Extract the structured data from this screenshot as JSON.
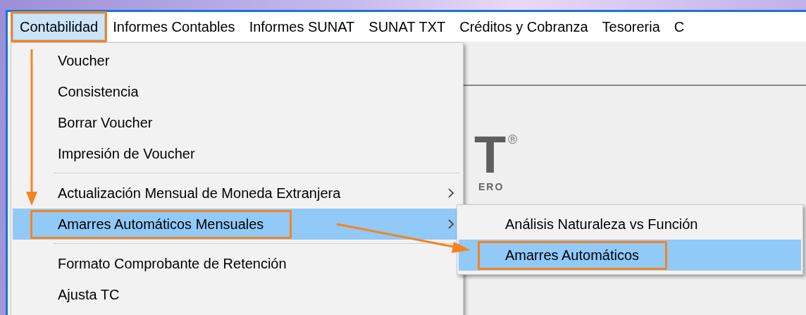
{
  "menu_bar": [
    {
      "label": "Contabilidad",
      "selected": true,
      "annotated": true
    },
    {
      "label": "Informes Contables",
      "selected": false,
      "annotated": false
    },
    {
      "label": "Informes SUNAT",
      "selected": false,
      "annotated": false
    },
    {
      "label": "SUNAT TXT",
      "selected": false,
      "annotated": false
    },
    {
      "label": "Créditos y Cobranza",
      "selected": false,
      "annotated": false
    },
    {
      "label": "Tesoreria",
      "selected": false,
      "annotated": false
    },
    {
      "label": "C",
      "selected": false,
      "annotated": false
    }
  ],
  "menu": {
    "items": [
      {
        "kind": "item",
        "label": "Voucher",
        "selected": false,
        "annotated": false,
        "has_submenu": false
      },
      {
        "kind": "item",
        "label": "Consistencia",
        "selected": false,
        "annotated": false,
        "has_submenu": false
      },
      {
        "kind": "item",
        "label": "Borrar Voucher",
        "selected": false,
        "annotated": false,
        "has_submenu": false
      },
      {
        "kind": "item",
        "label": "Impresión de Voucher",
        "selected": false,
        "annotated": false,
        "has_submenu": false
      },
      {
        "kind": "separator"
      },
      {
        "kind": "item",
        "label": "Actualización Mensual de Moneda Extranjera",
        "selected": false,
        "annotated": false,
        "has_submenu": true
      },
      {
        "kind": "item",
        "label": "Amarres Automáticos Mensuales",
        "selected": true,
        "annotated": true,
        "has_submenu": true
      },
      {
        "kind": "separator"
      },
      {
        "kind": "item",
        "label": "Formato Comprobante de Retención",
        "selected": false,
        "annotated": false,
        "has_submenu": false
      },
      {
        "kind": "item",
        "label": "Ajusta TC",
        "selected": false,
        "annotated": false,
        "has_submenu": false
      }
    ]
  },
  "submenu": {
    "items": [
      {
        "kind": "item",
        "label": "Análisis Naturaleza vs Función",
        "selected": false,
        "annotated": false,
        "has_submenu": false
      },
      {
        "kind": "item",
        "label": "Amarres Automáticos",
        "selected": true,
        "annotated": true,
        "has_submenu": false
      }
    ]
  },
  "logo": {
    "mark": "T",
    "registered": "®",
    "tagline": "ERO"
  }
}
